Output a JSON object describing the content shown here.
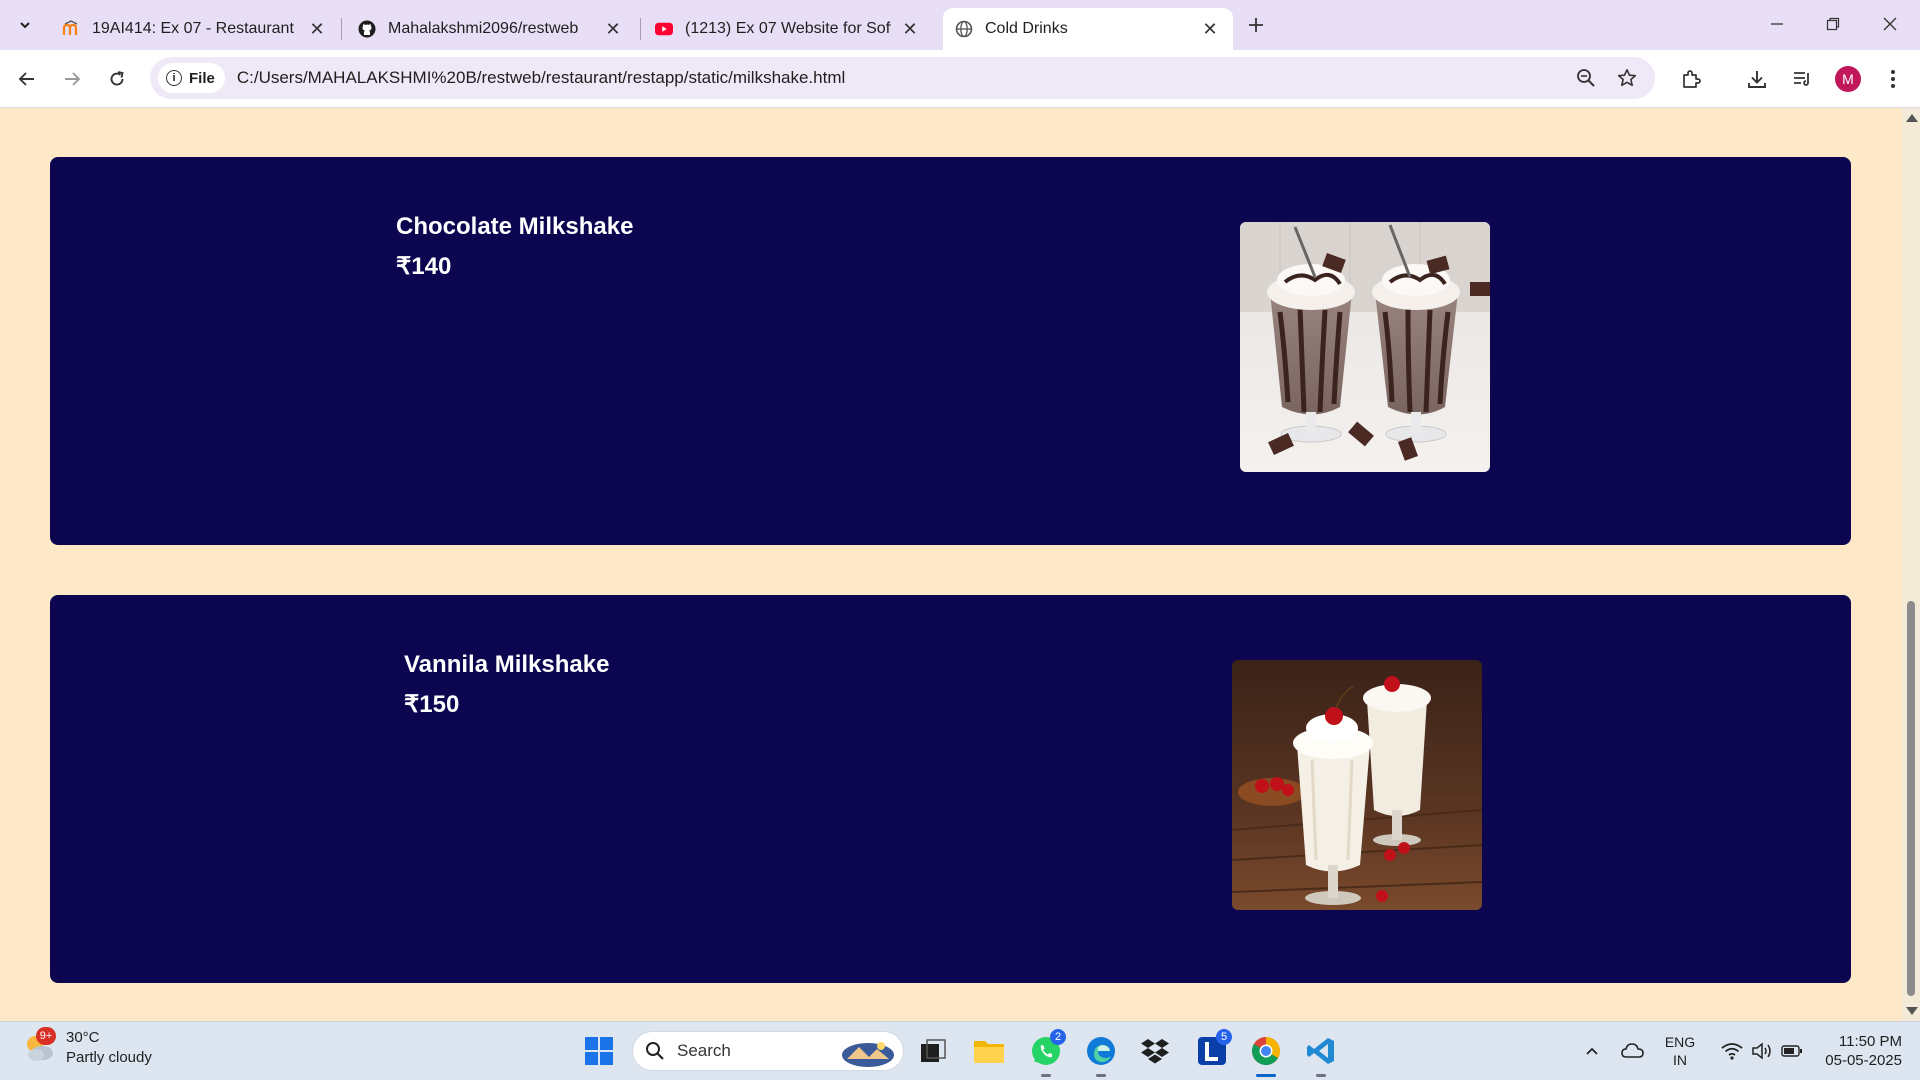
{
  "browser": {
    "tabs": [
      {
        "title": "19AI414: Ex 07 - Restaurant We",
        "icon": "moodle-icon"
      },
      {
        "title": "Mahalakshmi2096/restweb",
        "icon": "github-icon"
      },
      {
        "title": "(1213) Ex 07 Website for Softwa",
        "icon": "youtube-icon"
      },
      {
        "title": "Cold Drinks",
        "icon": "globe-icon",
        "active": true
      }
    ],
    "site_chip": "File",
    "url": "C:/Users/MAHALAKSHMI%20B/restweb/restaurant/restapp/static/milkshake.html",
    "profile_initial": "M"
  },
  "page": {
    "background": "#fde8c8",
    "card_color": "#0c0550",
    "items": [
      {
        "name": "Chocolate Milkshake",
        "price": "₹140"
      },
      {
        "name": "Vannila Milkshake",
        "price": "₹150"
      }
    ]
  },
  "taskbar": {
    "weather_badge": "9+",
    "temperature": "30°C",
    "condition": "Partly cloudy",
    "search_label": "Search",
    "whatsapp_badge": "2",
    "l_badge": "5",
    "lang_top": "ENG",
    "lang_bottom": "IN",
    "time": "11:50 PM",
    "date": "05-05-2025"
  }
}
